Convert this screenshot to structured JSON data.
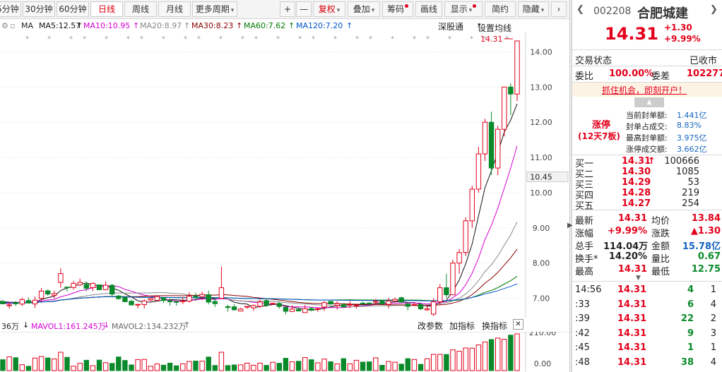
{
  "toolbar": {
    "tabs": [
      "5分钟",
      "30分钟",
      "60分钟",
      "日线",
      "周线",
      "月线",
      "更多周期"
    ],
    "active_tab": "日线",
    "plus": "+",
    "minus": "—",
    "fq": "复权",
    "overlay": "叠加",
    "chips": "筹码",
    "draw": "画线",
    "display": "显示",
    "simple": "简约",
    "hide": "隐藏"
  },
  "ma": {
    "label": "MA",
    "ma5": "MA5:12.57",
    "ma10": "MA10:10.95",
    "ma20": "MA20:8.97",
    "ma30": "MA30:8.23",
    "ma60": "MA60:7.62",
    "ma120": "MA120:7.20",
    "exchange": "深股通",
    "settings": "设置均线",
    "colors": {
      "ma5": "#111111",
      "ma10": "#d400d4",
      "ma20": "#888888",
      "ma30": "#8a0000",
      "ma60": "#007a00",
      "ma120": "#0055cc"
    }
  },
  "chart_data": {
    "type": "candlestick",
    "y_ticks": [
      "14.00",
      "13.00",
      "12.00",
      "11.00",
      "10.00",
      "9.00",
      "8.00",
      "7.00"
    ],
    "ylim": [
      6.45,
      14.55
    ],
    "current_price_label": "10.45",
    "last_price_marker": "14.31",
    "candles_last": [
      {
        "open": 6.55,
        "high": 7.0,
        "low": 6.5,
        "close": 6.9
      },
      {
        "open": 6.9,
        "high": 7.4,
        "low": 6.8,
        "close": 7.3
      },
      {
        "open": 7.3,
        "high": 7.7,
        "low": 7.0,
        "close": 7.1
      },
      {
        "open": 7.1,
        "high": 8.1,
        "low": 7.1,
        "close": 8.0
      },
      {
        "open": 8.0,
        "high": 8.4,
        "low": 7.7,
        "close": 8.3
      },
      {
        "open": 8.3,
        "high": 9.3,
        "low": 8.2,
        "close": 9.2
      },
      {
        "open": 9.2,
        "high": 10.2,
        "low": 9.0,
        "close": 10.1
      },
      {
        "open": 10.1,
        "high": 11.3,
        "low": 10.0,
        "close": 11.1
      },
      {
        "open": 11.1,
        "high": 12.1,
        "low": 10.9,
        "close": 12.0
      },
      {
        "open": 12.0,
        "high": 12.3,
        "low": 10.5,
        "close": 10.7
      },
      {
        "open": 10.7,
        "high": 11.9,
        "low": 10.5,
        "close": 11.8
      },
      {
        "open": 11.8,
        "high": 13.0,
        "low": 11.6,
        "close": 13.0
      },
      {
        "open": 13.0,
        "high": 13.1,
        "low": 12.2,
        "close": 12.8
      },
      {
        "open": 12.8,
        "high": 14.31,
        "low": 12.6,
        "close": 14.31
      }
    ]
  },
  "volume": {
    "label1": "36万",
    "mavol1": "MAVOL1:161.245万",
    "mavol2": "MAVOL2:134.232万",
    "change_params": "改参数",
    "add_indicator": "加指标",
    "switch_indicator": "换指标",
    "close": "✕",
    "y_ticks": [
      "210.00",
      "0.00"
    ]
  },
  "panel": {
    "code": "002208",
    "name": "合肥城建",
    "price": "14.31",
    "change": "+1.30",
    "change_pct": "+9.99%",
    "trade_status_label": "交易状态",
    "trade_status": "已收市",
    "weibi_label": "委比",
    "weibi": "100.00%",
    "weicha_label": "委差",
    "weicha": "102277",
    "promo": "抓住机会，即刻开户！",
    "limit_up": "涨停",
    "limit_up_sub": "(12天7板)",
    "seal_amount_label": "当前封单额:",
    "seal_amount": "1.441亿",
    "seal_ratio_label": "封单占成交:",
    "seal_ratio": "8.83%",
    "max_seal_label": "最高封单额:",
    "max_seal": "3.975亿",
    "limit_turnover_label": "涨停成交额:",
    "limit_turnover": "3.662亿",
    "bids": [
      {
        "label": "买一",
        "price": "14.31",
        "arrow": "↑",
        "vol": "100666"
      },
      {
        "label": "买二",
        "price": "14.30",
        "arrow": "",
        "vol": "1085"
      },
      {
        "label": "买三",
        "price": "14.29",
        "arrow": "",
        "vol": "53"
      },
      {
        "label": "买四",
        "price": "14.28",
        "arrow": "",
        "vol": "219"
      },
      {
        "label": "买五",
        "price": "14.27",
        "arrow": "",
        "vol": "254"
      }
    ],
    "stats": [
      {
        "l1": "最新",
        "v1": "14.31",
        "c1": "red",
        "l2": "均价",
        "v2": "13.84",
        "c2": "red"
      },
      {
        "l1": "涨幅",
        "v1": "+9.99%",
        "c1": "red",
        "l2": "涨跌",
        "v2": "▲1.30",
        "c2": "red"
      },
      {
        "l1": "总手",
        "v1": "114.04万",
        "c1": "",
        "l2": "金额",
        "v2": "15.78亿",
        "c2": "blue"
      },
      {
        "l1": "换手*",
        "v1": "14.20%",
        "c1": "",
        "l2": "量比",
        "v2": "0.67",
        "c2": "green"
      },
      {
        "l1": "最高",
        "v1": "14.31",
        "c1": "red",
        "l2": "最低",
        "v2": "12.75",
        "c2": "green"
      }
    ],
    "ticks": [
      {
        "time": "14:56",
        "price": "14.31",
        "vol": "4",
        "n": "1"
      },
      {
        "time": ":33",
        "price": "14.31",
        "vol": "6",
        "n": "4"
      },
      {
        "time": ":39",
        "price": "14.31",
        "vol": "22",
        "n": "2"
      },
      {
        "time": ":42",
        "price": "14.31",
        "vol": "9",
        "n": "3"
      },
      {
        "time": ":45",
        "price": "14.31",
        "vol": "1",
        "n": "1"
      },
      {
        "time": ":48",
        "price": "14.31",
        "vol": "38",
        "n": "4"
      }
    ]
  }
}
